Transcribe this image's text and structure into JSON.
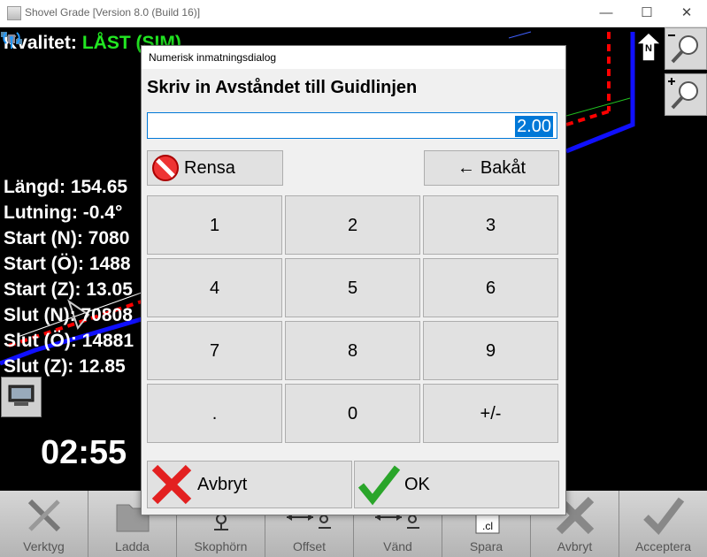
{
  "window": {
    "title": "Shovel Grade [Version 8.0 (Build 16)]",
    "minimize_glyph": "—",
    "maximize_glyph": "☐",
    "close_glyph": "✕"
  },
  "map": {
    "quality_label": "Kvalitet:",
    "quality_value": "LÅST (SIM)",
    "north_label": "N",
    "info_lines": [
      "Längd: 154.65",
      "Lutning: -0.4°",
      "Start (N): 7080",
      "Start (Ö): 1488",
      "Start (Z): 13.05",
      "Slut (N): 70808",
      "Slut (Ö): 14881",
      "Slut (Z): 12.85"
    ],
    "clock": "02:55"
  },
  "toolbar": {
    "items": [
      {
        "label": "Verktyg",
        "icon": "wrench-icon"
      },
      {
        "label": "Ladda",
        "icon": "folder-icon"
      },
      {
        "label": "Skophörn",
        "icon": "bucket-corner-icon"
      },
      {
        "label": "Offset",
        "icon": "offset-icon"
      },
      {
        "label": "Vänd",
        "icon": "reverse-icon"
      },
      {
        "label": "Spara",
        "icon": "save-file-icon",
        "badge": ".cl"
      },
      {
        "label": "Avbryt",
        "icon": "cancel-x-icon"
      },
      {
        "label": "Acceptera",
        "icon": "checkmark-icon"
      }
    ]
  },
  "dialog": {
    "title": "Numerisk inmatningsdialog",
    "heading": "Skriv in Avståndet till Guidlinjen",
    "value": "2.00",
    "clear_label": "Rensa",
    "back_label": "Bakåt",
    "back_arrow": "←",
    "keys": [
      "1",
      "2",
      "3",
      "4",
      "5",
      "6",
      "7",
      "8",
      "9",
      ".",
      "0",
      "+/-"
    ],
    "cancel_label": "Avbryt",
    "ok_label": "OK"
  },
  "colors": {
    "quality_value": "#22e622",
    "accent_blue": "#0078d7",
    "line_red": "#ff0000",
    "line_blue": "#1010ff"
  }
}
